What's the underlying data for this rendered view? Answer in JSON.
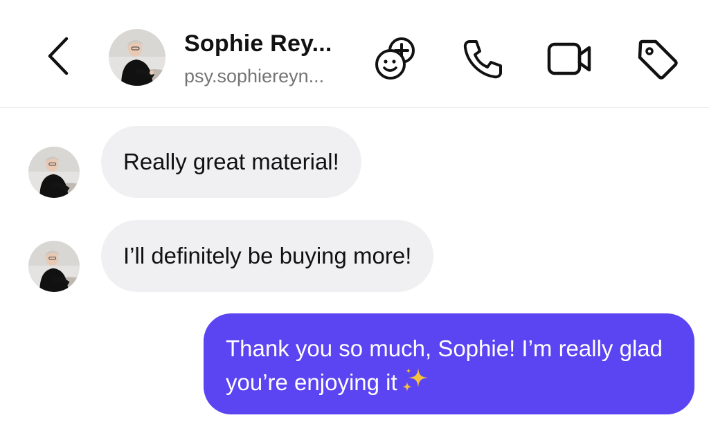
{
  "header": {
    "contact_name": "Sophie Rey...",
    "contact_handle": "psy.sophiereyn...",
    "icons": {
      "back": "chevron-left-icon",
      "add_people": "add-people-icon",
      "call": "phone-icon",
      "video": "video-camera-icon",
      "tag": "tag-icon"
    }
  },
  "messages": [
    {
      "direction": "incoming",
      "text": "Really great material!"
    },
    {
      "direction": "incoming",
      "text": "I’ll definitely be buying more!"
    },
    {
      "direction": "outgoing",
      "text": "Thank you so much, Sophie! I’m really glad you’re enjoying it",
      "emoji": "sparkles"
    }
  ],
  "colors": {
    "outgoing_bubble": "#5b44f2",
    "incoming_bubble": "#f0f0f2",
    "handle_text": "#747474",
    "sparkle": "#f5c33b"
  }
}
